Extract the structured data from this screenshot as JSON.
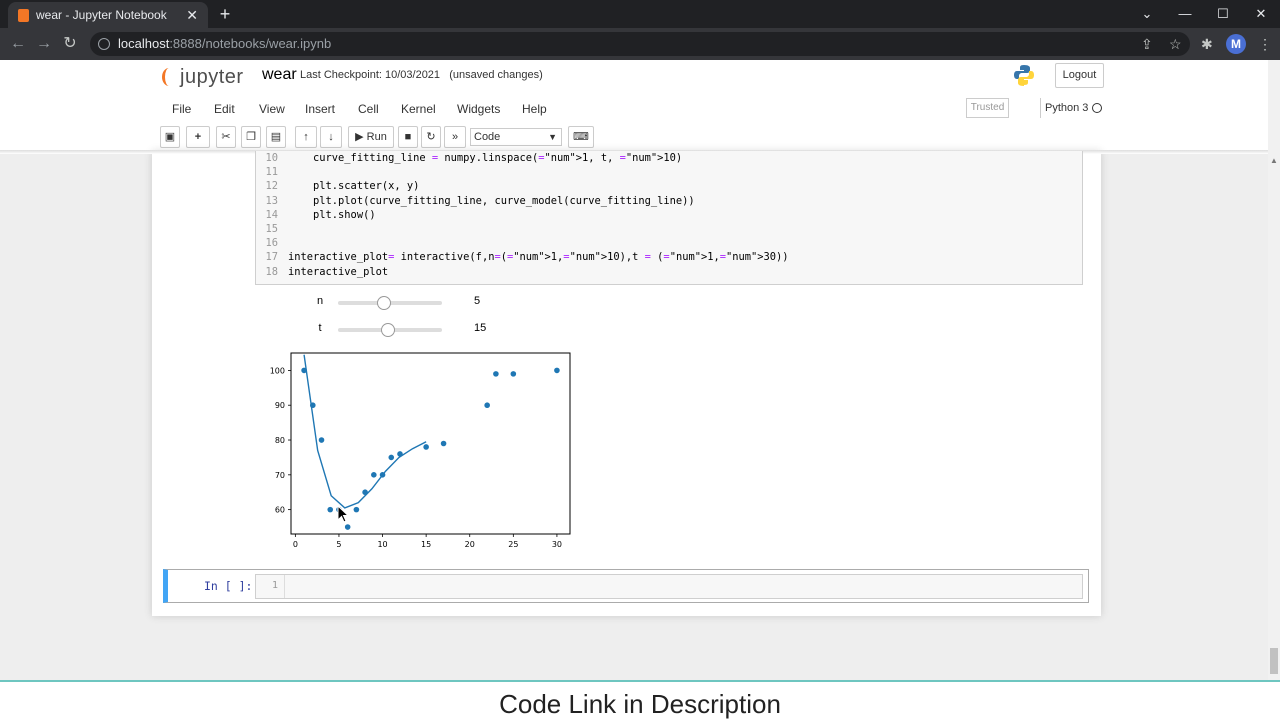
{
  "browser": {
    "tab_title": "wear - Jupyter Notebook",
    "new_tab": "+",
    "url_host": "localhost",
    "url_path": ":8888/notebooks/wear.ipynb",
    "avatar_letter": "M",
    "window_controls": [
      "—",
      "☐",
      "✕"
    ]
  },
  "header": {
    "logo_text": "jupyter",
    "notebook_name": "wear",
    "checkpoint": "Last Checkpoint: 10/03/2021   (unsaved changes)",
    "logout_label": "Logout"
  },
  "menubar": {
    "items": [
      "File",
      "Edit",
      "View",
      "Insert",
      "Cell",
      "Kernel",
      "Widgets",
      "Help"
    ],
    "trusted": "Trusted",
    "kernel_name": "Python 3"
  },
  "toolbar": {
    "run_label": "Run",
    "cell_type": "Code"
  },
  "code_lines": [
    {
      "n": "10",
      "text": "    curve_fitting_line = numpy.linspace(1, t, 10)"
    },
    {
      "n": "11",
      "text": ""
    },
    {
      "n": "12",
      "text": "    plt.scatter(x, y)"
    },
    {
      "n": "13",
      "text": "    plt.plot(curve_fitting_line, curve_model(curve_fitting_line))"
    },
    {
      "n": "14",
      "text": "    plt.show()"
    },
    {
      "n": "15",
      "text": ""
    },
    {
      "n": "16",
      "text": ""
    },
    {
      "n": "17",
      "text": "interactive_plot= interactive(f,n=(1,10),t = (1,30))"
    },
    {
      "n": "18",
      "text": "interactive_plot"
    }
  ],
  "widgets": {
    "n_label": "n",
    "n_value": "5",
    "n_fraction": 0.44,
    "t_label": "t",
    "t_value": "15",
    "t_fraction": 0.48
  },
  "chart_data": {
    "type": "scatter",
    "xlim": [
      -0.5,
      31.5
    ],
    "ylim": [
      53,
      105
    ],
    "xticks": [
      0,
      5,
      10,
      15,
      20,
      25,
      30
    ],
    "yticks": [
      60,
      70,
      80,
      90,
      100
    ],
    "grid": false,
    "scatter": {
      "x": [
        1,
        2,
        3,
        4,
        5,
        6,
        7,
        8,
        9,
        10,
        11,
        12,
        15,
        17,
        22,
        23,
        25,
        30
      ],
      "y": [
        100,
        90,
        80,
        60,
        60,
        55,
        60,
        65,
        70,
        70,
        75,
        76,
        78,
        79,
        90,
        99,
        99,
        100
      ]
    },
    "line": {
      "x": [
        1,
        2.56,
        4.11,
        5.67,
        7.22,
        8.78,
        10.33,
        11.89,
        13.44,
        15
      ],
      "y": [
        104.5,
        77,
        64,
        60.5,
        62,
        66,
        71,
        75,
        77.5,
        79.5
      ]
    }
  },
  "cell2": {
    "prompt": "In [ ]:",
    "line_number": "1"
  },
  "caption": "Code Link in Description"
}
